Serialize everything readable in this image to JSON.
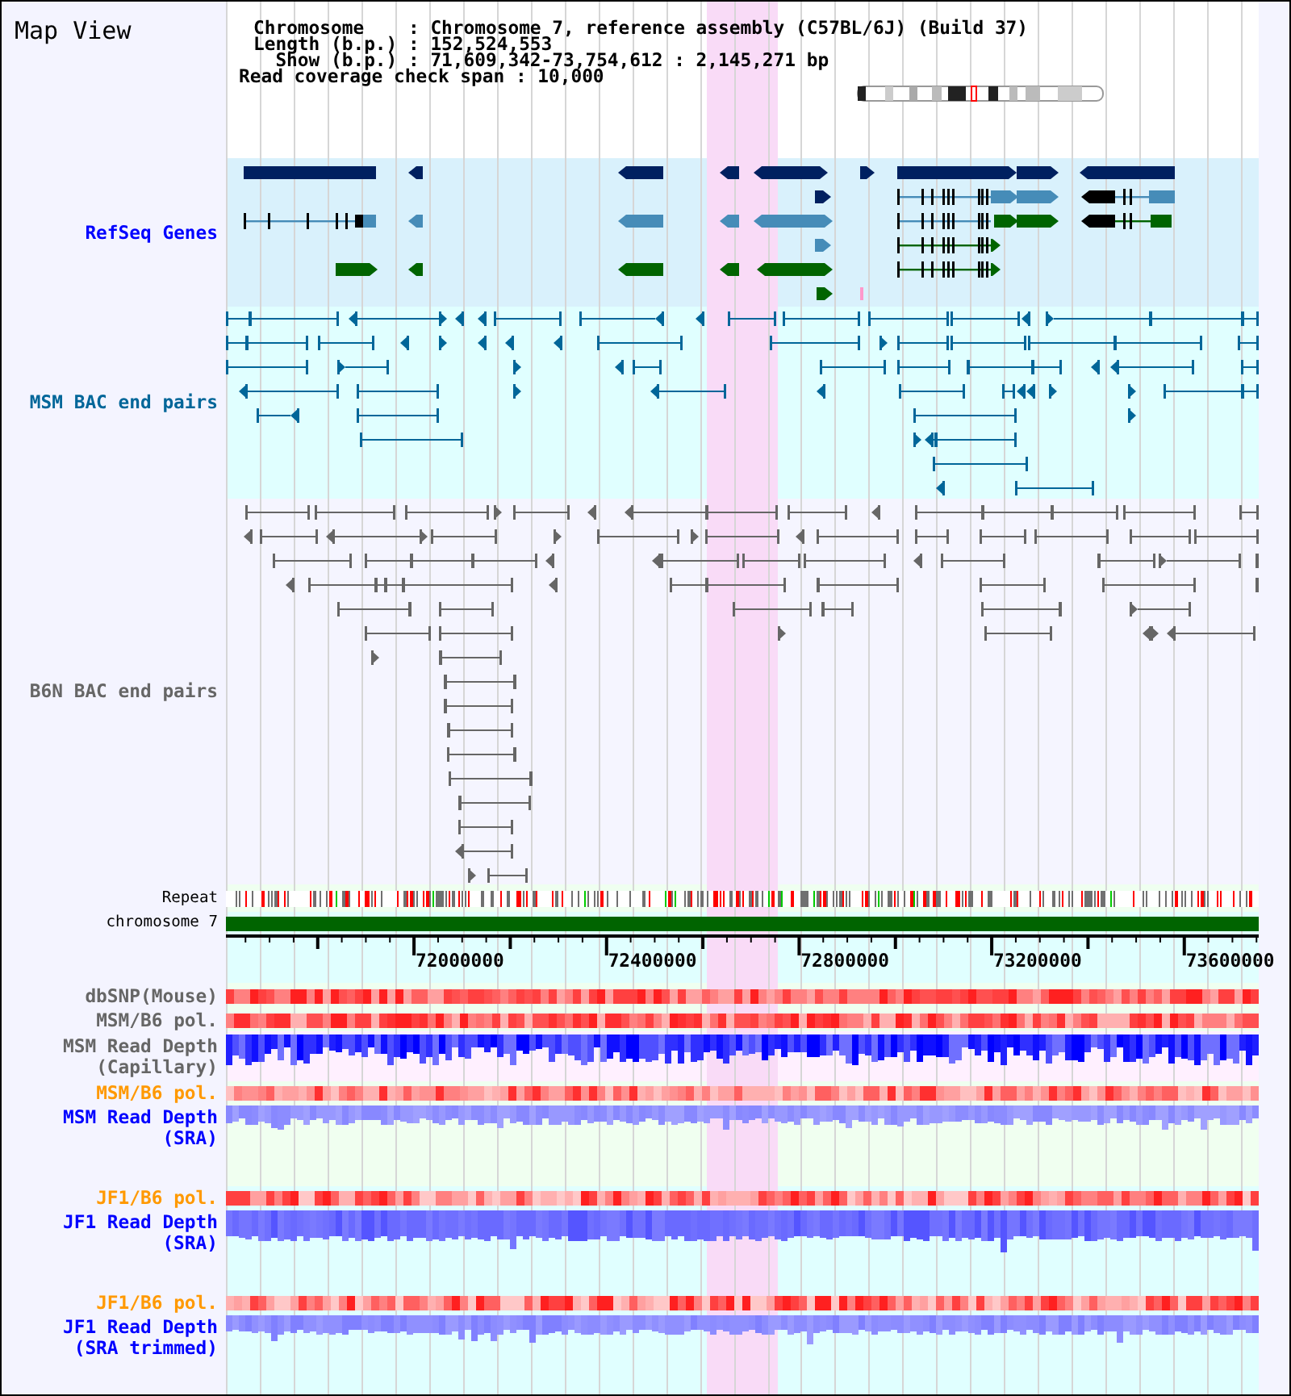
{
  "title": "Map View",
  "summary": {
    "lines": [
      {
        "label": "Chromosome",
        "separator": ":",
        "value": "Chromosome 7, reference assembly (C57BL/6J) (Build 37)"
      },
      {
        "label": "Length (b.p.)",
        "separator": ":",
        "value": "152,524,553"
      },
      {
        "label": "Show (b.p.)",
        "separator": ":",
        "value": "71,609,342-73,754,612 : 2,145,271 bp"
      }
    ],
    "coverage": {
      "label": "Read coverage check span",
      "separator": ":",
      "value": "10,000"
    }
  },
  "tracks": [
    {
      "kind": "genes",
      "label": "RefSeq Genes",
      "color": "#0000ff"
    },
    {
      "kind": "pairs",
      "label": "MSM BAC end pairs",
      "color": "#006699"
    },
    {
      "kind": "pairs",
      "label": "B6N BAC end pairs",
      "color": "#666666"
    },
    {
      "kind": "repeat",
      "label": "Repeat",
      "color": "#000000"
    },
    {
      "kind": "chromosome",
      "label": "chromosome 7",
      "color": "#000000"
    },
    {
      "kind": "ruler",
      "ticks": [
        "72000000",
        "72400000",
        "72800000",
        "73200000",
        "73600000"
      ]
    },
    {
      "kind": "heat",
      "label": "dbSNP(Mouse)",
      "color": "#666666"
    },
    {
      "kind": "heat",
      "label": "MSM/B6 pol.",
      "color": "#666666"
    },
    {
      "kind": "depth",
      "label": "MSM Read Depth",
      "note": "(Capillary)",
      "color": "#666666"
    },
    {
      "kind": "heat",
      "label": "MSM/B6 pol.",
      "color": "#ff9900"
    },
    {
      "kind": "depth",
      "label": "MSM Read Depth",
      "note": "(SRA)",
      "color": "#0000ff"
    },
    {
      "kind": "heat",
      "label": "JF1/B6 pol.",
      "color": "#ff9900"
    },
    {
      "kind": "depth",
      "label": "JF1 Read Depth",
      "note": "(SRA)",
      "color": "#0000ff"
    },
    {
      "kind": "heat",
      "label": "JF1/B6 pol.",
      "color": "#ff9900"
    },
    {
      "kind": "depth",
      "label": "JF1 Read Depth",
      "note": "(SRA trimmed)",
      "color": "#0000ff"
    }
  ]
}
